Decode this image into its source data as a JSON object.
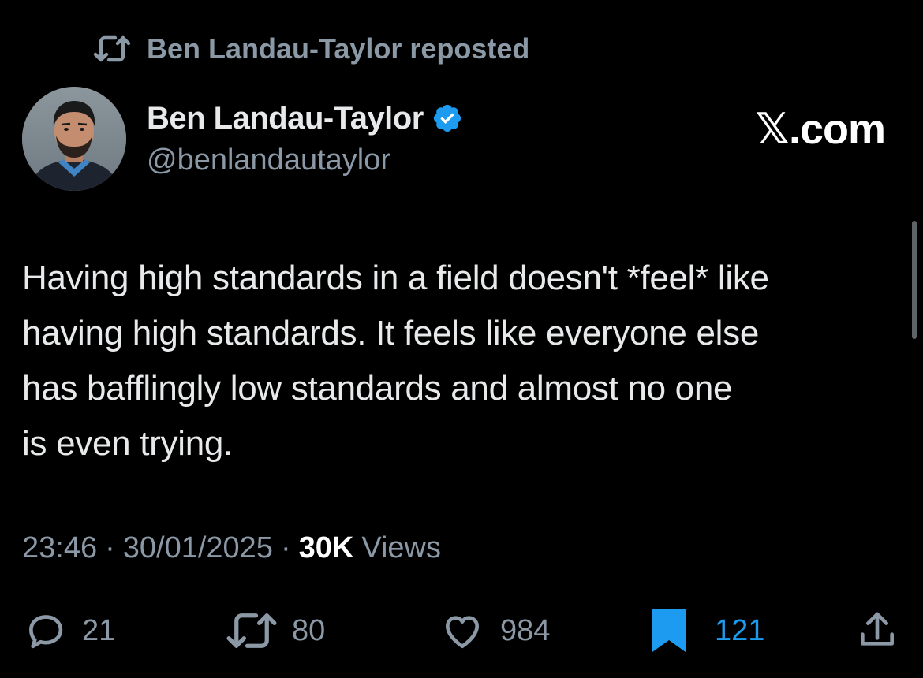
{
  "repost_banner": {
    "icon": "repost-icon",
    "text": "Ben Landau-Taylor reposted"
  },
  "author": {
    "avatar_icon": "avatar",
    "name": "Ben Landau-Taylor",
    "verified_icon": "verified-badge-icon",
    "handle": "@benlandautaylor"
  },
  "brand": "𝕏.com",
  "tweet": {
    "lines": [
      "Having high standards in a field doesn't *feel* like",
      "having high standards. It feels like everyone else",
      "has bafflingly low standards and almost no one",
      "is even trying."
    ]
  },
  "meta": {
    "time": "23:46",
    "separator": "·",
    "date": "30/01/2025",
    "views_count": "30K",
    "views_label": "Views"
  },
  "actions": {
    "reply": {
      "icon": "reply-icon",
      "count": "21"
    },
    "repost": {
      "icon": "repost-icon",
      "count": "80"
    },
    "like": {
      "icon": "heart-icon",
      "count": "984"
    },
    "bookmark": {
      "icon": "bookmark-icon",
      "count": "121",
      "active": true
    },
    "share": {
      "icon": "share-icon"
    }
  },
  "colors": {
    "background": "#000000",
    "text": "#e7e9ea",
    "muted": "#8b98a5",
    "accent": "#1d9bf0"
  }
}
